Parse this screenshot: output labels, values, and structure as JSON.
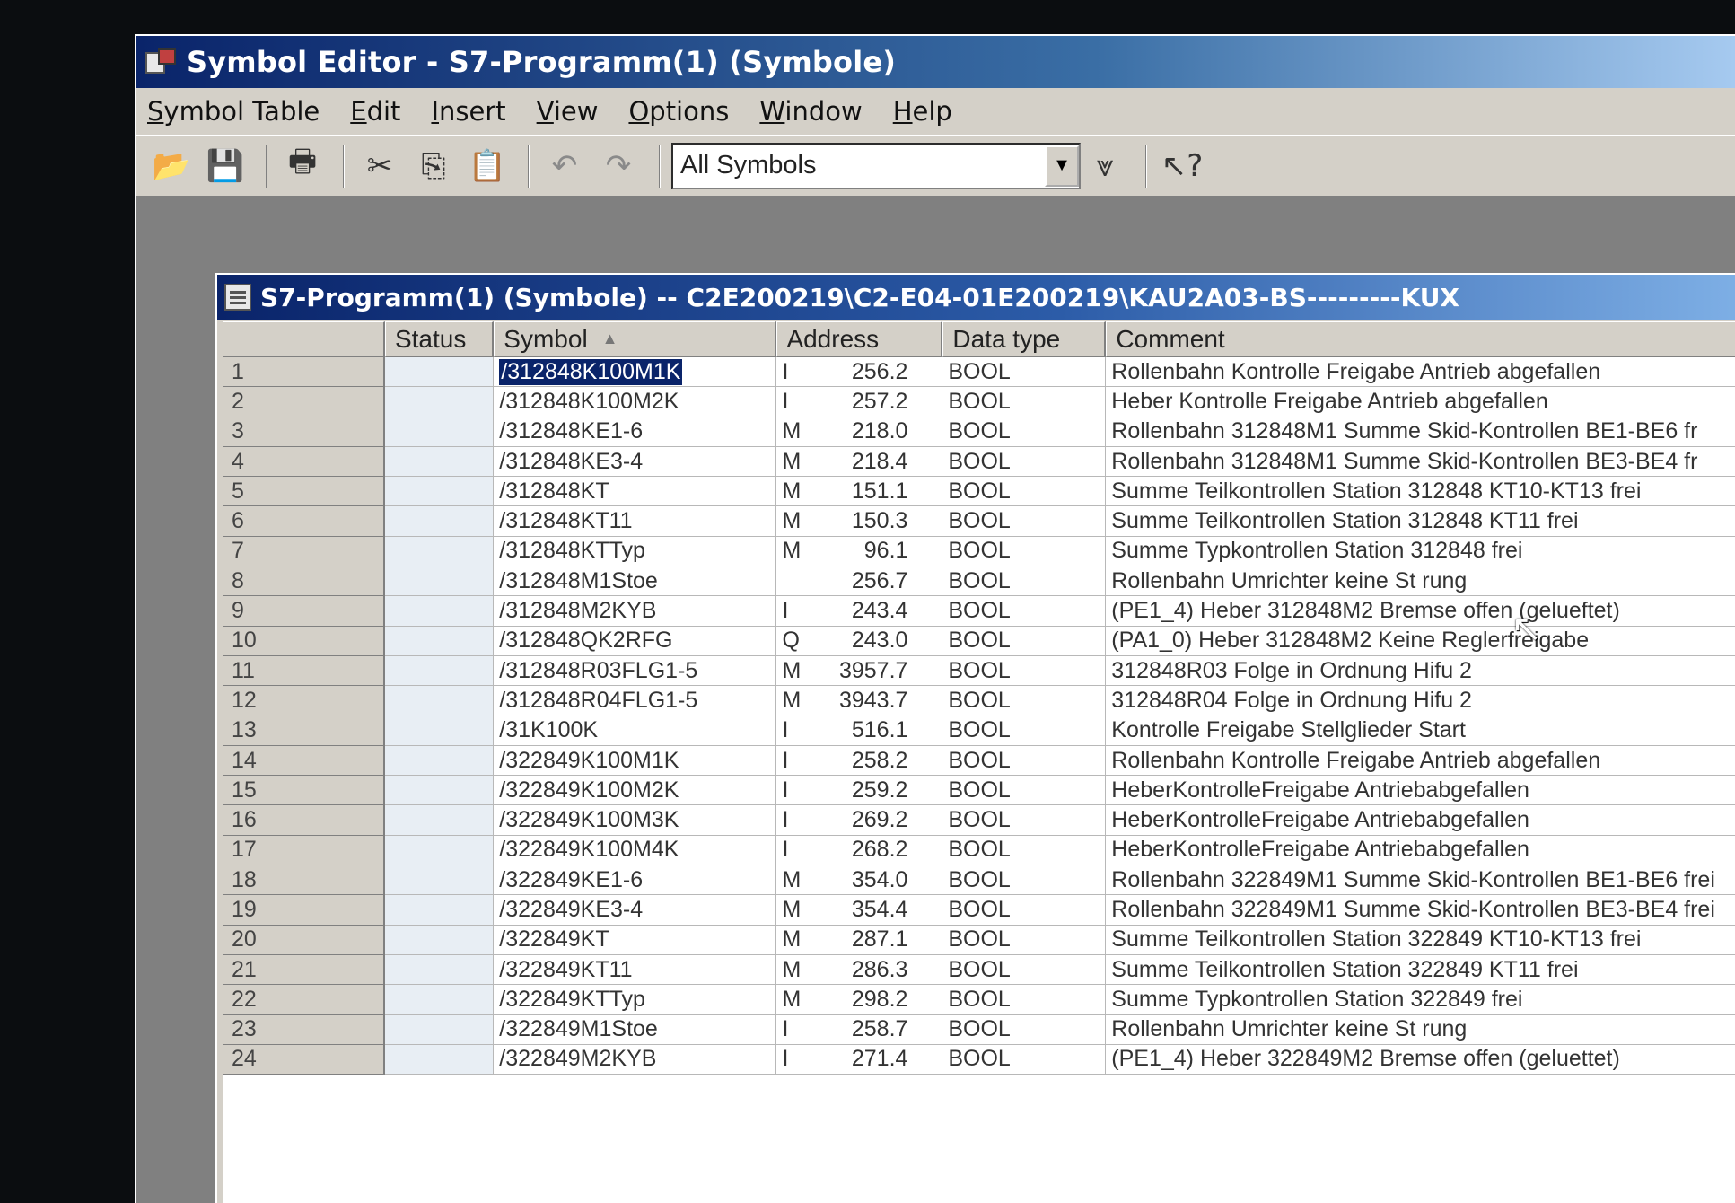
{
  "window": {
    "title": "Symbol Editor - S7-Programm(1) (Symbole)"
  },
  "menu": [
    "Symbol Table",
    "Edit",
    "Insert",
    "View",
    "Options",
    "Window",
    "Help"
  ],
  "toolbar": {
    "filter_value": "All Symbols",
    "icons": [
      "open-icon",
      "save-icon",
      "print-icon",
      "cut-icon",
      "copy-icon",
      "paste-icon",
      "undo-icon",
      "redo-icon",
      "filter-icon",
      "help-pointer-icon"
    ]
  },
  "table_window": {
    "title": "S7-Programm(1) (Symbole) -- C2E200219\\C2-E04-01E200219\\KAU2A03-BS---------KUX"
  },
  "table": {
    "headers": [
      "",
      "Status",
      "Symbol",
      "Address",
      "Data type",
      "Comment"
    ],
    "sort_indicator": "▲",
    "rows": [
      {
        "n": "1",
        "symbol": "/312848K100M1K",
        "area": "I",
        "addr": "256.2",
        "type": "BOOL",
        "comment": "Rollenbahn Kontrolle Freigabe Antrieb abgefallen"
      },
      {
        "n": "2",
        "symbol": "/312848K100M2K",
        "area": "I",
        "addr": "257.2",
        "type": "BOOL",
        "comment": "Heber Kontrolle Freigabe Antrieb abgefallen"
      },
      {
        "n": "3",
        "symbol": "/312848KE1-6",
        "area": "M",
        "addr": "218.0",
        "type": "BOOL",
        "comment": "Rollenbahn 312848M1 Summe Skid-Kontrollen BE1-BE6 fr"
      },
      {
        "n": "4",
        "symbol": "/312848KE3-4",
        "area": "M",
        "addr": "218.4",
        "type": "BOOL",
        "comment": "Rollenbahn 312848M1 Summe Skid-Kontrollen BE3-BE4 fr"
      },
      {
        "n": "5",
        "symbol": "/312848KT",
        "area": "M",
        "addr": "151.1",
        "type": "BOOL",
        "comment": "Summe Teilkontrollen Station 312848 KT10-KT13  frei"
      },
      {
        "n": "6",
        "symbol": "/312848KT11",
        "area": "M",
        "addr": "150.3",
        "type": "BOOL",
        "comment": "Summe Teilkontrollen Station 312848 KT11  frei"
      },
      {
        "n": "7",
        "symbol": "/312848KTTyp",
        "area": "M",
        "addr": "96.1",
        "type": "BOOL",
        "comment": "Summe Typkontrollen Station 312848 frei"
      },
      {
        "n": "8",
        "symbol": "/312848M1Stoe",
        "area": "",
        "addr": "256.7",
        "type": "BOOL",
        "comment": "Rollenbahn Umrichter keine St rung"
      },
      {
        "n": "9",
        "symbol": "/312848M2KYB",
        "area": "I",
        "addr": "243.4",
        "type": "BOOL",
        "comment": "(PE1_4) Heber 312848M2 Bremse offen (gelueftet)"
      },
      {
        "n": "10",
        "symbol": "/312848QK2RFG",
        "area": "Q",
        "addr": "243.0",
        "type": "BOOL",
        "comment": "(PA1_0) Heber 312848M2 Keine Reglerfreigabe"
      },
      {
        "n": "11",
        "symbol": "/312848R03FLG1-5",
        "area": "M",
        "addr": "3957.7",
        "type": "BOOL",
        "comment": "312848R03 Folge in Ordnung Hifu 2"
      },
      {
        "n": "12",
        "symbol": "/312848R04FLG1-5",
        "area": "M",
        "addr": "3943.7",
        "type": "BOOL",
        "comment": "312848R04 Folge in Ordnung Hifu 2"
      },
      {
        "n": "13",
        "symbol": "/31K100K",
        "area": "I",
        "addr": "516.1",
        "type": "BOOL",
        "comment": "Kontrolle Freigabe Stellglieder Start"
      },
      {
        "n": "14",
        "symbol": "/322849K100M1K",
        "area": "I",
        "addr": "258.2",
        "type": "BOOL",
        "comment": "Rollenbahn Kontrolle Freigabe Antrieb abgefallen"
      },
      {
        "n": "15",
        "symbol": "/322849K100M2K",
        "area": "I",
        "addr": "259.2",
        "type": "BOOL",
        "comment": "HeberKontrolleFreigabe Antriebabgefallen"
      },
      {
        "n": "16",
        "symbol": "/322849K100M3K",
        "area": "I",
        "addr": "269.2",
        "type": "BOOL",
        "comment": "HeberKontrolleFreigabe Antriebabgefallen"
      },
      {
        "n": "17",
        "symbol": "/322849K100M4K",
        "area": "I",
        "addr": "268.2",
        "type": "BOOL",
        "comment": "HeberKontrolleFreigabe Antriebabgefallen"
      },
      {
        "n": "18",
        "symbol": "/322849KE1-6",
        "area": "M",
        "addr": "354.0",
        "type": "BOOL",
        "comment": "Rollenbahn 322849M1 Summe Skid-Kontrollen BE1-BE6 frei"
      },
      {
        "n": "19",
        "symbol": "/322849KE3-4",
        "area": "M",
        "addr": "354.4",
        "type": "BOOL",
        "comment": "Rollenbahn 322849M1 Summe Skid-Kontrollen BE3-BE4 frei"
      },
      {
        "n": "20",
        "symbol": "/322849KT",
        "area": "M",
        "addr": "287.1",
        "type": "BOOL",
        "comment": "Summe Teilkontrollen Station 322849 KT10-KT13  frei"
      },
      {
        "n": "21",
        "symbol": "/322849KT11",
        "area": "M",
        "addr": "286.3",
        "type": "BOOL",
        "comment": "Summe Teilkontrollen Station 322849 KT11  frei"
      },
      {
        "n": "22",
        "symbol": "/322849KTTyp",
        "area": "M",
        "addr": "298.2",
        "type": "BOOL",
        "comment": "Summe Typkontrollen Station 322849 frei"
      },
      {
        "n": "23",
        "symbol": "/322849M1Stoe",
        "area": "I",
        "addr": "258.7",
        "type": "BOOL",
        "comment": "Rollenbahn Umrichter keine St rung"
      },
      {
        "n": "24",
        "symbol": "/322849M2KYB",
        "area": "I",
        "addr": "271.4",
        "type": "BOOL",
        "comment": "(PE1_4) Heber 322849M2 Bremse offen (geluettet)"
      }
    ]
  },
  "colors": {
    "title_active": "#0a246a",
    "face": "#d4d0c8",
    "selection": "#0a246a"
  }
}
